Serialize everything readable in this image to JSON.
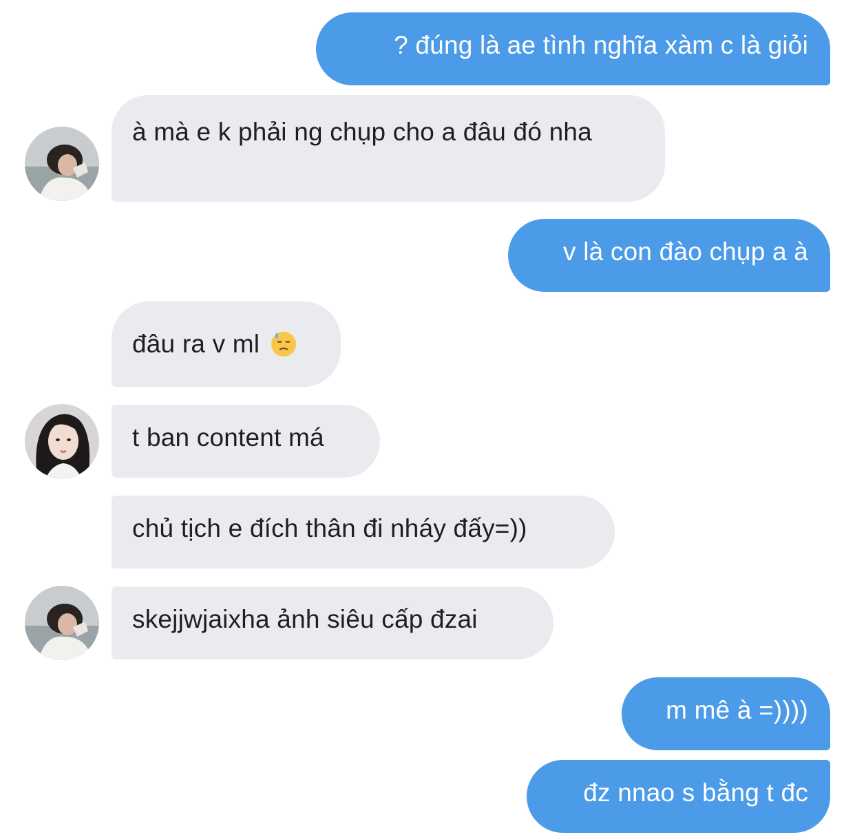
{
  "messages": [
    {
      "side": "out",
      "text": "? đúng là ae tình nghĩa xàm c là giỏi"
    },
    {
      "side": "in",
      "text": "à mà e k phải ng chụp cho a đâu đó nha"
    },
    {
      "side": "out",
      "text": "v là con đào chụp a à"
    },
    {
      "side": "in",
      "text": "đâu ra v ml",
      "emoji": "downcast-sweat-emoji"
    },
    {
      "side": "in",
      "text": "t ban content má"
    },
    {
      "side": "in",
      "text": "chủ tịch e đích thân đi nháy đấy=))"
    },
    {
      "side": "in",
      "text": "skejjwjaixha ảnh siêu cấp đzai"
    },
    {
      "side": "out",
      "text": "m mê à =))))"
    },
    {
      "side": "out",
      "text": "đz nnao s bằng t đc"
    }
  ],
  "colors": {
    "outgoing_bubble": "#4c9be8",
    "incoming_bubble": "#e9ebef",
    "incoming_text": "#1e1f22",
    "outgoing_text": "#ffffff"
  }
}
